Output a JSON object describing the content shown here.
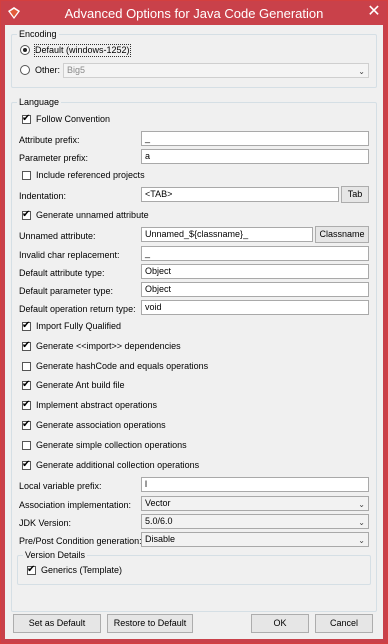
{
  "window": {
    "title": "Advanced Options for Java Code Generation",
    "close_glyph": "✕"
  },
  "encoding": {
    "legend": "Encoding",
    "default_label": "Default (windows-1252)",
    "default_selected": true,
    "other_label": "Other:",
    "other_selected": false,
    "other_value": "Big5"
  },
  "language": {
    "legend": "Language",
    "follow_convention": {
      "label": "Follow Convention",
      "checked": true
    },
    "attribute_prefix": {
      "label": "Attribute prefix:",
      "value": "_"
    },
    "parameter_prefix": {
      "label": "Parameter prefix:",
      "value": "a"
    },
    "include_referenced": {
      "label": "Include referenced projects",
      "checked": false
    },
    "indentation": {
      "label": "Indentation:",
      "value": "<TAB>",
      "button": "Tab"
    },
    "generate_unnamed": {
      "label": "Generate unnamed attribute",
      "checked": true
    },
    "unnamed_attribute": {
      "label": "Unnamed attribute:",
      "value": "Unnamed_${classname}_",
      "button": "Classname"
    },
    "invalid_char": {
      "label": "Invalid char replacement:",
      "value": "_"
    },
    "default_attribute_type": {
      "label": "Default attribute type:",
      "value": "Object"
    },
    "default_parameter_type": {
      "label": "Default parameter type:",
      "value": "Object"
    },
    "default_return_type": {
      "label": "Default operation return type:",
      "value": "void"
    },
    "options": [
      {
        "label": "Import Fully Qualified",
        "checked": true
      },
      {
        "label": "Generate <<import>> dependencies",
        "checked": true
      },
      {
        "label": "Generate hashCode and equals operations",
        "checked": false
      },
      {
        "label": "Generate Ant build file",
        "checked": true
      },
      {
        "label": "Implement abstract operations",
        "checked": true
      },
      {
        "label": "Generate association operations",
        "checked": true
      },
      {
        "label": "Generate simple collection operations",
        "checked": false
      },
      {
        "label": "Generate additional collection operations",
        "checked": true
      }
    ],
    "local_variable_prefix": {
      "label": "Local variable prefix:",
      "value": "l"
    },
    "association_impl": {
      "label": "Association implementation:",
      "value": "Vector"
    },
    "jdk_version": {
      "label": "JDK Version:",
      "value": "5.0/6.0"
    },
    "pre_post": {
      "label": "Pre/Post Condition generation:",
      "value": "Disable"
    },
    "version_details": {
      "legend": "Version Details",
      "generics": {
        "label": "Generics (Template)",
        "checked": true
      }
    }
  },
  "footer": {
    "set_default": "Set as Default",
    "restore_default": "Restore to Default",
    "ok": "OK",
    "cancel": "Cancel"
  },
  "icons": {
    "app": "vp-logo-icon",
    "dropdown": "chevron-down-icon",
    "check": "check-icon"
  },
  "colors": {
    "titlebar": "#c9414a",
    "dialog_bg": "#f0f0f0"
  }
}
